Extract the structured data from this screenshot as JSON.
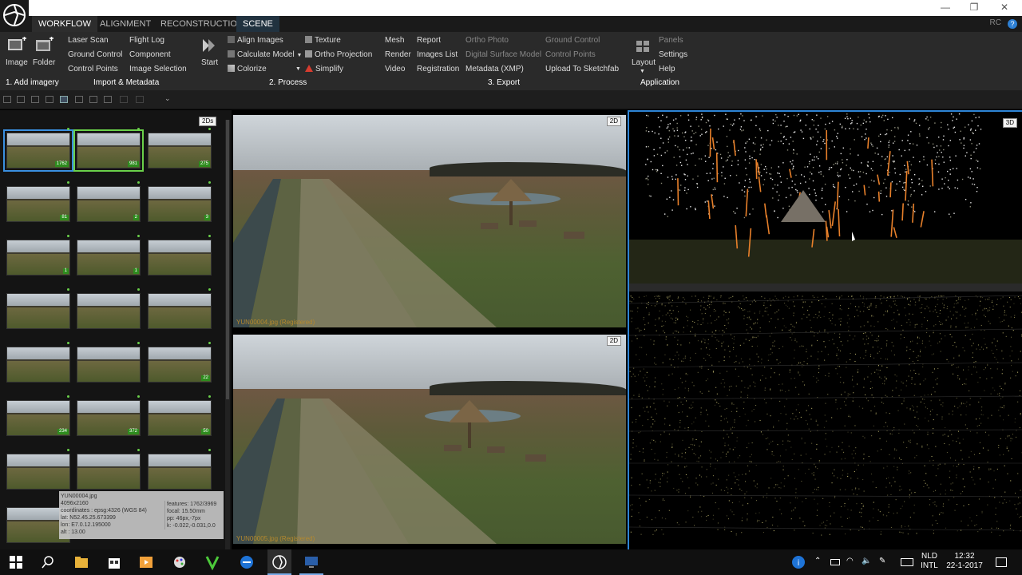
{
  "window": {
    "minimize": "—",
    "restore": "❐",
    "close": "✕",
    "rc": "RC",
    "help": "?"
  },
  "tabs": [
    "WORKFLOW",
    "ALIGNMENT",
    "RECONSTRUCTION",
    "SCENE"
  ],
  "ribbon": {
    "image": "Image",
    "folder": "Folder",
    "laser_scan": "Laser Scan",
    "ground_control": "Ground Control",
    "control_points": "Control Points",
    "flight_log": "Flight Log",
    "component": "Component",
    "image_selection": "Image Selection",
    "start": "Start",
    "align_images": "Align Images",
    "calculate_model": "Calculate Model",
    "colorize": "Colorize",
    "texture": "Texture",
    "ortho_projection": "Ortho Projection",
    "simplify": "Simplify",
    "mesh": "Mesh",
    "render": "Render",
    "video": "Video",
    "report": "Report",
    "images_list": "Images List",
    "registration": "Registration",
    "ortho_photo": "Ortho Photo",
    "dsm": "Digital Surface Model",
    "metadata": "Metadata (XMP)",
    "ground_control_2": "Ground Control",
    "control_points_2": "Control Points",
    "upload_sketchfab": "Upload To Sketchfab",
    "layout": "Layout",
    "panels": "Panels",
    "settings": "Settings",
    "help": "Help",
    "group_add": "1. Add imagery",
    "group_import": "Import & Metadata",
    "group_process": "2. Process",
    "group_export": "3. Export",
    "group_app": "Application"
  },
  "left_panel": {
    "view_tag": "2Ds",
    "thumbs": [
      {
        "badge": "1762"
      },
      {
        "badge": "981"
      },
      {
        "badge": "275"
      },
      {
        "badge": "81"
      },
      {
        "badge": "2"
      },
      {
        "badge": "3"
      },
      {
        "badge": "1"
      },
      {
        "badge": "1"
      },
      {
        "badge": ""
      },
      {
        "badge": ""
      },
      {
        "badge": ""
      },
      {
        "badge": ""
      },
      {
        "badge": ""
      },
      {
        "badge": ""
      },
      {
        "badge": "22"
      },
      {
        "badge": "234"
      },
      {
        "badge": "372"
      },
      {
        "badge": "50"
      },
      {
        "badge": ""
      },
      {
        "badge": ""
      },
      {
        "badge": ""
      },
      {
        "badge": ""
      }
    ]
  },
  "tooltip": {
    "filename": "YUN00004.jpg",
    "resolution": "4096x2160",
    "coordinates": "coordinates : epsg:4326 (WGS 84)",
    "lat": "lat: N52.45.25.673399",
    "lon": "lon: E7.0.12.195000",
    "alt": "alt : 13.00",
    "features": "features: 1762/3969",
    "focal": "focal: 15.50mm",
    "pp": "pp: 46px,-7px",
    "k": "k: -0.022,-0.031,0.0"
  },
  "views": {
    "top_tag": "2D",
    "bottom_tag": "2D",
    "top_caption": "YUN00004.jpg (Registered)",
    "bottom_caption": "YUN00005.jpg (Registered)",
    "view3d_tag": "3D"
  },
  "taskbar": {
    "lang": "NLD",
    "layout": "INTL",
    "time": "12:32",
    "date": "22-1-2017"
  },
  "colors": {
    "accent_blue": "#2d84d6",
    "selected_green": "#6ad04a"
  }
}
